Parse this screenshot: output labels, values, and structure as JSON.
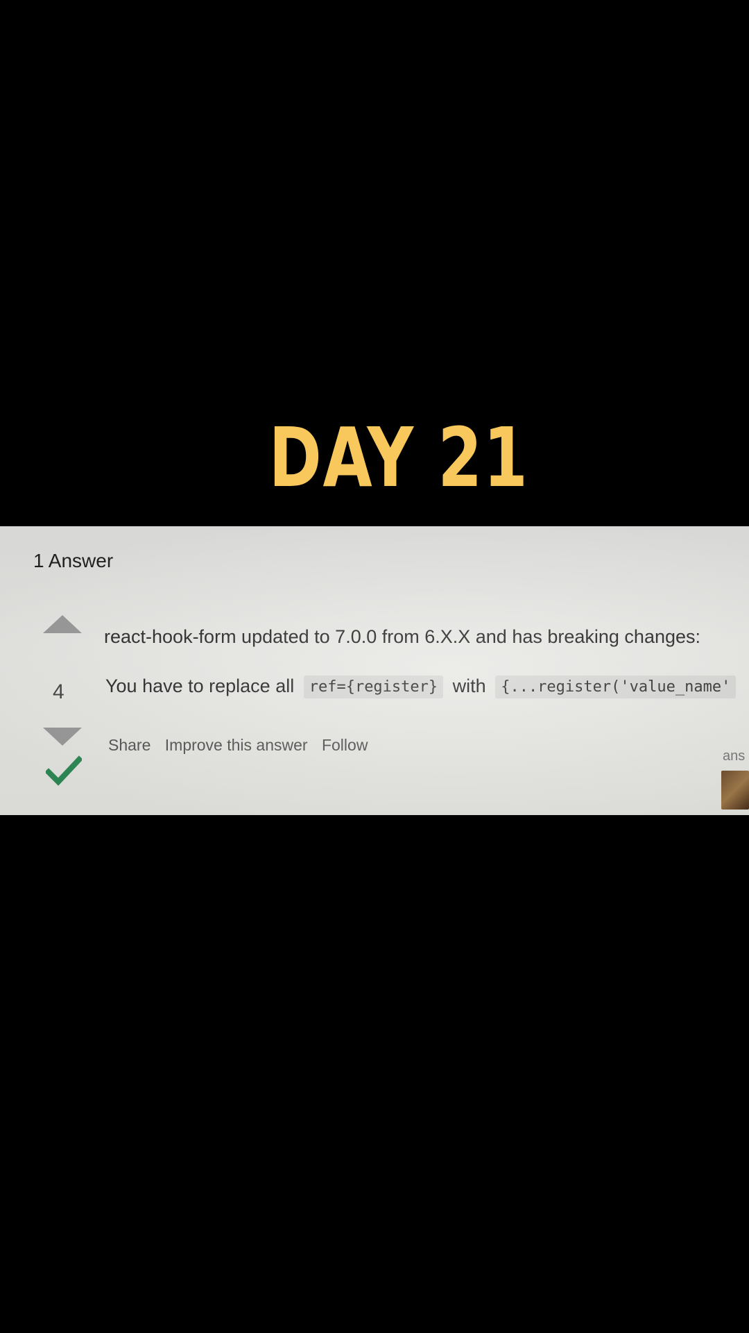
{
  "overlay": {
    "title": "DAY 21"
  },
  "question": {
    "answers_header": "1 Answer"
  },
  "answer": {
    "vote_count": "4",
    "line1": "react-hook-form updated to 7.0.0 from 6.X.X and has breaking changes:",
    "line2_prefix": "You have to replace all",
    "code1": "ref={register}",
    "line2_middle": "with",
    "code2": "{...register('value_name'",
    "menu": {
      "share": "Share",
      "improve": "Improve this answer",
      "follow": "Follow"
    },
    "answered_label": "ans"
  },
  "colors": {
    "title": "#F9C85C",
    "accepted": "#2E8B57",
    "vote_arrow": "#9a9a9a"
  }
}
